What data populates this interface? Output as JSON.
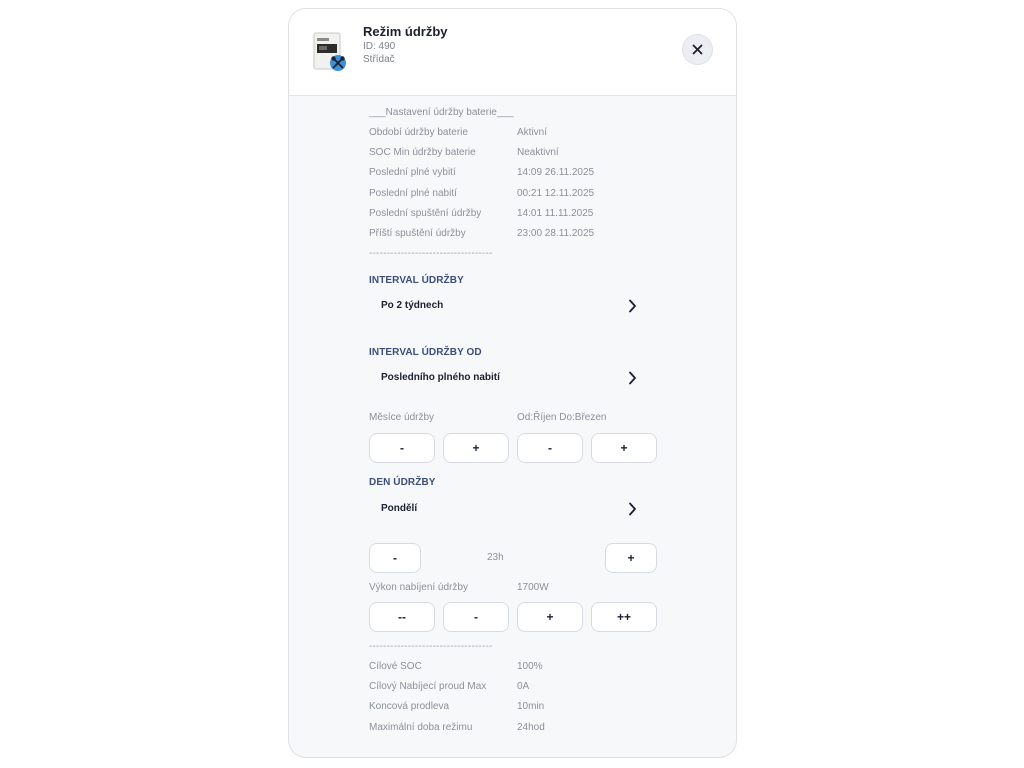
{
  "header": {
    "title": "Režim údržby",
    "id_text": "ID: 490",
    "device_type": "Střídač",
    "device_icon": "inverter-maintenance-icon",
    "close_icon": "close-icon"
  },
  "battery_settings": {
    "heading": "___Nastavení údržby baterie___",
    "rows": [
      {
        "label": "Období údržby baterie",
        "value": "Aktivní"
      },
      {
        "label": "SOC Min údržby baterie",
        "value": "Neaktivní"
      },
      {
        "label": "Poslední plné vybití",
        "value": "14:09 26.11.2025"
      },
      {
        "label": "Poslední plné nabití",
        "value": "00:21 12.11.2025"
      },
      {
        "label": "Poslední spuštění údržby",
        "value": "14:01 11.11.2025"
      },
      {
        "label": "Příští spuštění údržby",
        "value": "23:00 28.11.2025"
      }
    ],
    "separator": "-----------------------------------"
  },
  "interval": {
    "title": "INTERVAL ÚDRŽBY",
    "value": "Po 2 týdnech"
  },
  "interval_from": {
    "title": "INTERVAL ÚDRŽBY OD",
    "value": "Posledního plného nabití"
  },
  "months": {
    "label": "Měsíce údržby",
    "value": "Od:Říjen Do:Březen",
    "buttons": [
      "-",
      "+",
      "-",
      "+"
    ]
  },
  "day": {
    "title": "DEN ÚDRŽBY",
    "value": "Pondělí"
  },
  "hour": {
    "minus": "-",
    "value": "23h",
    "plus": "+"
  },
  "power": {
    "label": "Výkon nabíjení údržby",
    "value": "1700W",
    "buttons": [
      "--",
      "-",
      "+",
      "++"
    ]
  },
  "footer": {
    "separator": "-----------------------------------",
    "rows": [
      {
        "label": "Cílové SOC",
        "value": "100%"
      },
      {
        "label": "Cílový Nabíjecí proud Max",
        "value": "0A"
      },
      {
        "label": "Koncová prodleva",
        "value": "10min"
      },
      {
        "label": "Maximální doba režimu",
        "value": "24hod"
      }
    ]
  },
  "colors": {
    "accent": "#3b4e7a",
    "background": "#f7f8fa",
    "text": "#1b2030",
    "muted": "#8b9099",
    "wrench_badge": "#3d8fd6"
  }
}
